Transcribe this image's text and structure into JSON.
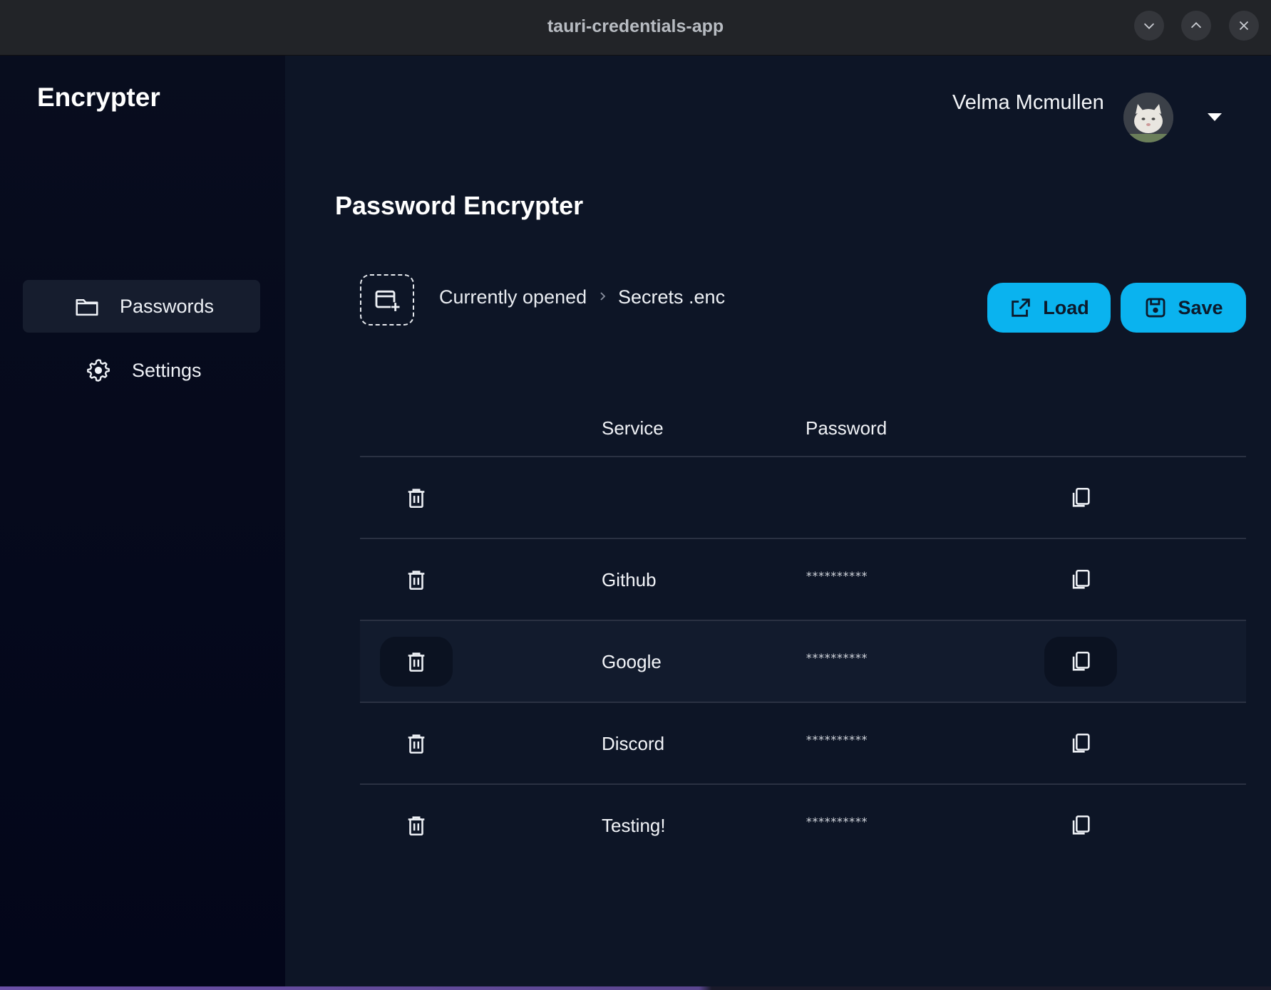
{
  "window": {
    "title": "tauri-credentials-app"
  },
  "sidebar": {
    "brand": "Encrypter",
    "items": [
      {
        "label": "Passwords",
        "icon": "folder-icon",
        "active": true
      },
      {
        "label": "Settings",
        "icon": "gear-icon",
        "active": false
      }
    ]
  },
  "header": {
    "user_name": "Velma Mcmullen"
  },
  "main": {
    "title": "Password Encrypter",
    "breadcrumb": {
      "label": "Currently opened",
      "file": "Secrets .enc"
    },
    "buttons": {
      "load": "Load",
      "save": "Save"
    },
    "table": {
      "columns": [
        "Service",
        "Password"
      ],
      "rows": [
        {
          "service": "",
          "password": ""
        },
        {
          "service": "Github",
          "password": "**********"
        },
        {
          "service": "Google",
          "password": "**********"
        },
        {
          "service": "Discord",
          "password": "**********"
        },
        {
          "service": "Testing!",
          "password": "**********"
        }
      ]
    }
  },
  "colors": {
    "accent": "#0ab3ef",
    "background": "#0d1526",
    "sidebar": "#060a1c"
  }
}
